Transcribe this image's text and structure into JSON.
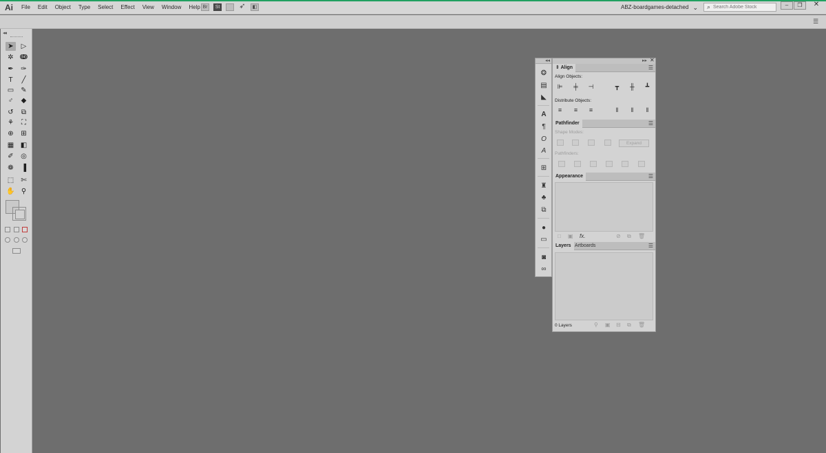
{
  "app": {
    "logo": "Ai",
    "menus": [
      "File",
      "Edit",
      "Object",
      "Type",
      "Select",
      "Effect",
      "View",
      "Window",
      "Help"
    ],
    "workspace": "ABZ-boardgames-detached",
    "search_placeholder": "Search Adobe Stock",
    "bridge_badge": "Br",
    "stock_badge": "St"
  },
  "panels": {
    "align": {
      "tab": "Align",
      "align_objects_label": "Align Objects:",
      "distribute_objects_label": "Distribute Objects:"
    },
    "pathfinder": {
      "tab": "Pathfinder",
      "shape_modes_label": "Shape Modes:",
      "expand_label": "Expand",
      "pathfinders_label": "Pathfinders:"
    },
    "appearance": {
      "tab": "Appearance",
      "fx_label": "fx."
    },
    "layers": {
      "tab": "Layers",
      "artboards_tab": "Artboards",
      "count_label": "0 Layers"
    }
  },
  "colors": {
    "canvas": "#6e6e6e",
    "chrome": "#d6d6d6",
    "panel": "#d3d3d3",
    "accent_line": "#20a060"
  },
  "icons": {
    "tools": [
      "selection-tool",
      "direct-selection-tool",
      "magic-wand-tool",
      "lasso-tool",
      "pen-tool",
      "curvature-tool",
      "type-tool",
      "line-segment-tool",
      "rectangle-tool",
      "paintbrush-tool",
      "shaper-tool",
      "eraser-tool",
      "rotate-tool",
      "scale-tool",
      "width-tool",
      "free-transform-tool",
      "shape-builder-tool",
      "perspective-grid-tool",
      "mesh-tool",
      "gradient-tool",
      "eyedropper-tool",
      "blend-tool",
      "symbol-sprayer-tool",
      "column-graph-tool",
      "artboard-tool",
      "slice-tool",
      "hand-tool",
      "zoom-tool"
    ]
  }
}
